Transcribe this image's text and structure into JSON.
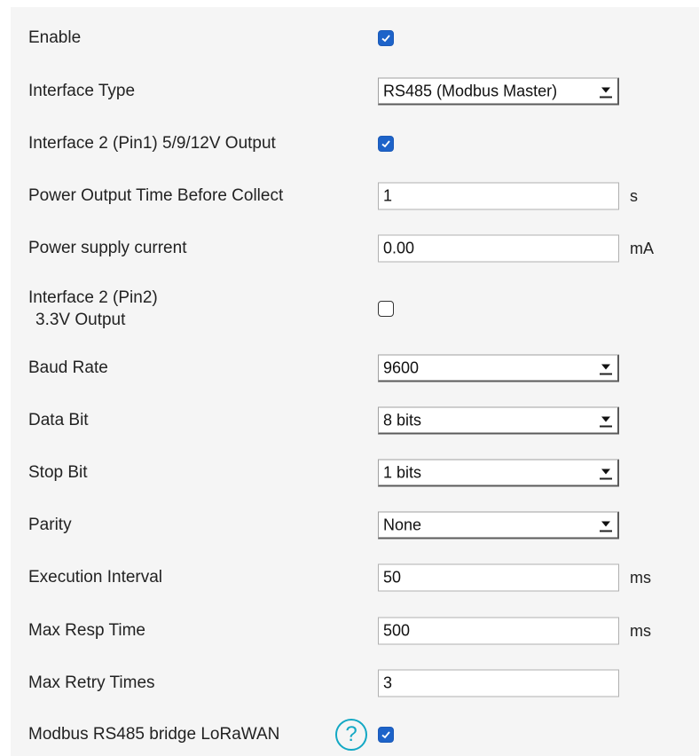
{
  "rows": [
    {
      "label": "Enable",
      "control": "checkbox",
      "checked": true
    },
    {
      "label": "Interface Type",
      "control": "select",
      "value": "RS485 (Modbus Master)"
    },
    {
      "label": "Interface 2 (Pin1) 5/9/12V Output",
      "control": "checkbox",
      "checked": true
    },
    {
      "label": "Power Output Time Before Collect",
      "control": "text",
      "value": "1",
      "unit": "s"
    },
    {
      "label": "Power supply current",
      "control": "text",
      "value": "0.00",
      "unit": "mA"
    },
    {
      "label": "Interface 2 (Pin2)",
      "label_line2": "3.3V Output",
      "control": "checkbox",
      "checked": false
    },
    {
      "label": "Baud Rate",
      "control": "select",
      "value": "9600"
    },
    {
      "label": "Data Bit",
      "control": "select",
      "value": "8 bits"
    },
    {
      "label": "Stop Bit",
      "control": "select",
      "value": "1 bits"
    },
    {
      "label": "Parity",
      "control": "select",
      "value": "None"
    },
    {
      "label": "Execution Interval",
      "control": "text",
      "value": "50",
      "unit": "ms"
    },
    {
      "label": "Max Resp Time",
      "control": "text",
      "value": "500",
      "unit": "ms"
    },
    {
      "label": "Max Retry Times",
      "control": "text",
      "value": "3"
    },
    {
      "label": "Modbus RS485 bridge LoRaWAN",
      "control": "checkbox",
      "checked": true,
      "help": "?"
    }
  ],
  "colors": {
    "checkbox_checked": "#1d63c9",
    "help_icon": "#13a8c4",
    "panel_bg": "#f5f5f5"
  }
}
